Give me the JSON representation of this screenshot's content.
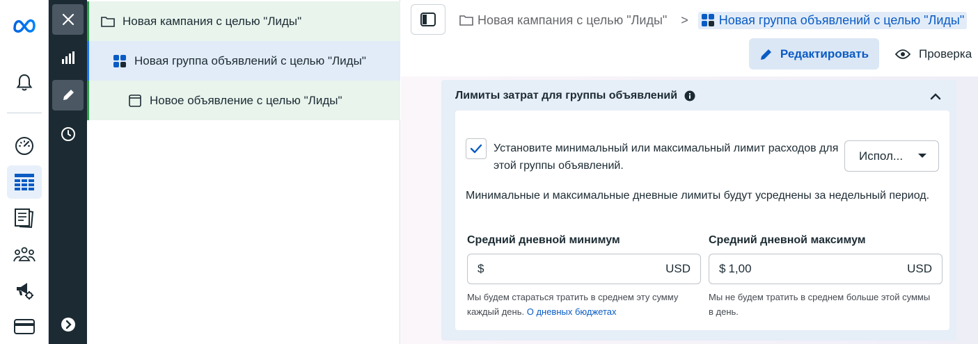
{
  "tree": {
    "campaign_label": "Новая кампания с целью \"Лиды\"",
    "adset_label": "Новая группа объявлений с целью \"Лиды\"",
    "ad_label": "Новое объявление с целью \"Лиды\""
  },
  "breadcrumb": {
    "campaign": "Новая кампания с целью \"Лиды\"",
    "separator": ">",
    "current": "Новая группа объявлений с целью \"Лиды\""
  },
  "toolbar": {
    "edit_label": "Редактировать",
    "review_label": "Проверка"
  },
  "section": {
    "title": "Лимиты затрат для группы объявлений",
    "checkbox_label": "Установите минимальный или максимальный лимит расходов для этой группы объявлений.",
    "checkbox_checked": true,
    "select_value": "Испол...",
    "note": "Минимальные и максимальные дневные лимиты будут усреднены за недельный период.",
    "min": {
      "label": "Средний дневной минимум",
      "currency_symbol": "$",
      "value": "",
      "unit": "USD",
      "hint": "Мы будем стараться тратить в среднем эту сумму каждый день.",
      "link": "О дневных бюджетах"
    },
    "max": {
      "label": "Средний дневной максимум",
      "currency_symbol": "$",
      "value": "1,00",
      "unit": "USD",
      "hint": "Мы не будем тратить в среднем больше этой суммы в день."
    }
  },
  "colors": {
    "accent": "#0a5bc4",
    "sidebar_dark": "#1c2b33",
    "campaign_row": "#e8f4ec",
    "adset_row": "#e2ecf8"
  }
}
